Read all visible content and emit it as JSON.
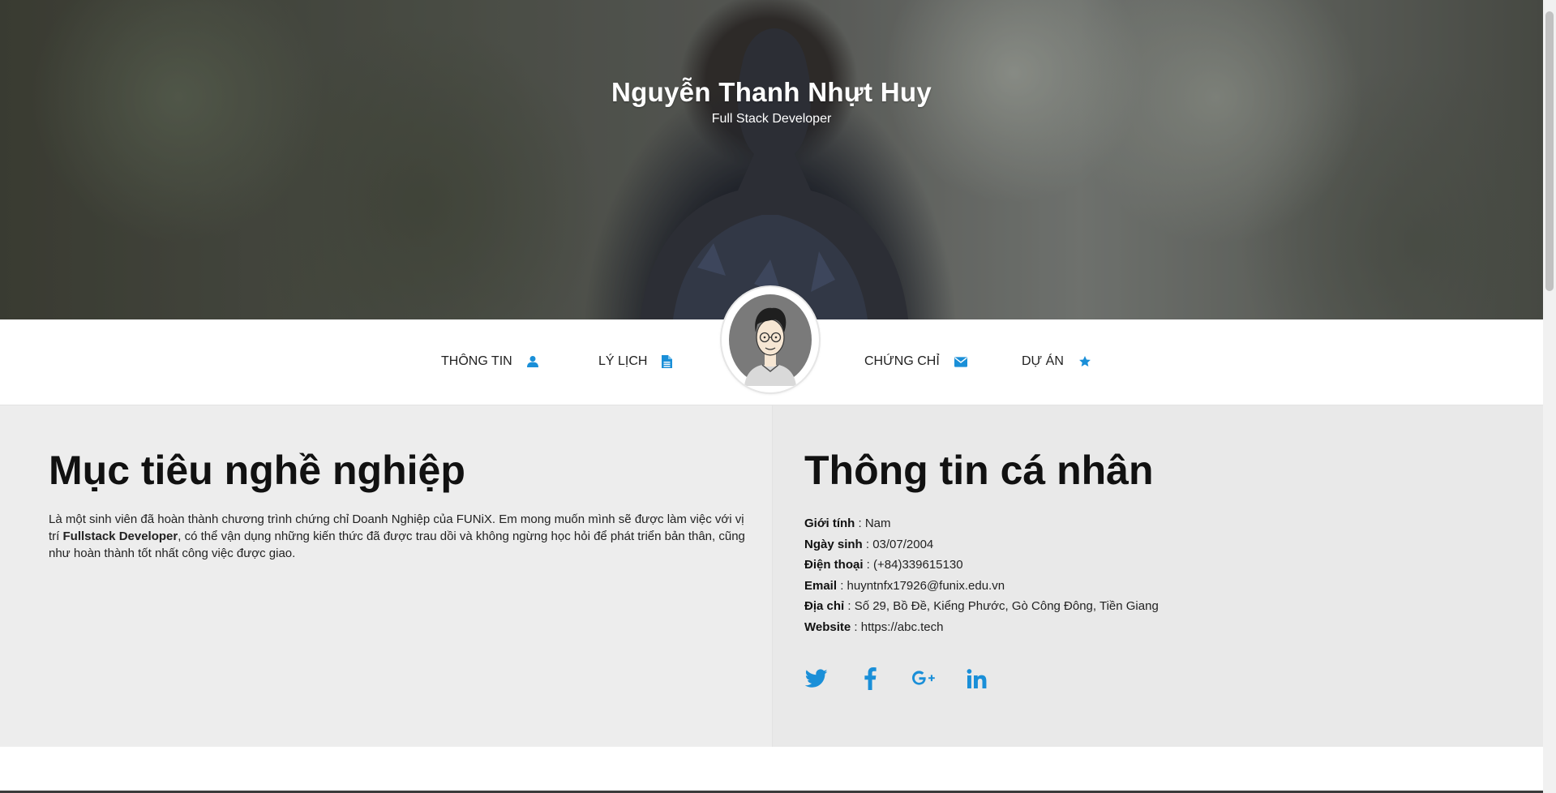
{
  "header": {
    "name": "Nguyễn Thanh Nhựt Huy",
    "role": "Full Stack Developer"
  },
  "nav": {
    "items": [
      {
        "label": "THÔNG TIN",
        "icon": "user-icon"
      },
      {
        "label": "LÝ LỊCH",
        "icon": "file-icon"
      },
      {
        "label": "CHỨNG CHỈ",
        "icon": "envelope-icon"
      },
      {
        "label": "DỰ ÁN",
        "icon": "star-icon"
      }
    ],
    "accent_color": "#1a8fd8"
  },
  "objective": {
    "title": "Mục tiêu nghề nghiệp",
    "text_before": "Là một sinh viên đã hoàn thành chương trình chứng chỉ Doanh Nghiệp của FUNiX. Em mong muốn mình sẽ được làm việc với vị trí ",
    "text_bold": "Fullstack Developer",
    "text_after": ", có thể vận dụng những kiến thức đã được trau dồi và không ngừng học hỏi để phát triển bản thân, cũng như hoàn thành tốt nhất công việc được giao."
  },
  "personal": {
    "title": "Thông tin cá nhân",
    "rows": [
      {
        "label": "Giới tính",
        "value": " : Nam"
      },
      {
        "label": "Ngày sinh",
        "value": " : 03/07/2004"
      },
      {
        "label": "Điện thoại",
        "value": " : (+84)339615130"
      },
      {
        "label": "Email",
        "value": " : huyntnfx17926@funix.edu.vn"
      },
      {
        "label": "Địa chỉ",
        "value": " : Số 29, Bồ Đề, Kiểng Phước, Gò Công Đông, Tiền Giang"
      },
      {
        "label": "Website",
        "value": " : https://abc.tech"
      }
    ],
    "socials": [
      "twitter-icon",
      "facebook-icon",
      "google-plus-icon",
      "linkedin-icon"
    ]
  }
}
